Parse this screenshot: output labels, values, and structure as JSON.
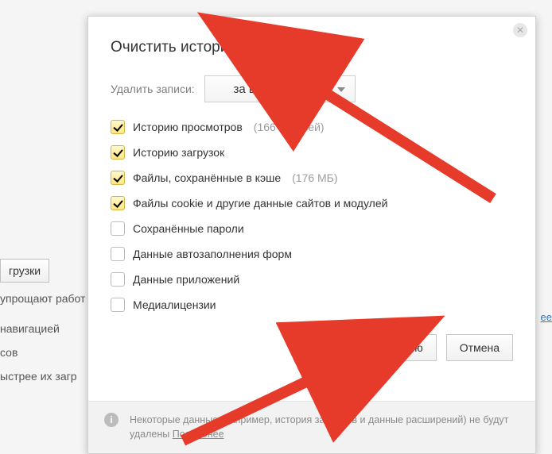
{
  "background": {
    "btn": "грузки",
    "line1": "упрощают работ",
    "line2": "навигацией",
    "line3": "сов",
    "line4": "ыстрее их загр",
    "rightLink": "ее"
  },
  "modal": {
    "title": "Очистить историю",
    "deleteLabel": "Удалить записи:",
    "range": "за всё время",
    "checks": [
      {
        "label": "Историю просмотров",
        "sub": "(166 записей)",
        "checked": true
      },
      {
        "label": "Историю загрузок",
        "sub": "",
        "checked": true
      },
      {
        "label": "Файлы, сохранённые в кэше",
        "sub": "(176 МБ)",
        "checked": true
      },
      {
        "label": "Файлы cookie и другие данные сайтов и модулей",
        "sub": "",
        "checked": true
      },
      {
        "label": "Сохранённые пароли",
        "sub": "",
        "checked": false
      },
      {
        "label": "Данные автозаполнения форм",
        "sub": "",
        "checked": false
      },
      {
        "label": "Данные приложений",
        "sub": "",
        "checked": false
      },
      {
        "label": "Медиалицензии",
        "sub": "",
        "checked": false
      }
    ],
    "clearBtn": "Очистить историю",
    "cancelBtn": "Отмена",
    "info": "Некоторые данные (например, история запросов и данные расширений) не будут удалены",
    "infoLink": "Подробнее"
  }
}
